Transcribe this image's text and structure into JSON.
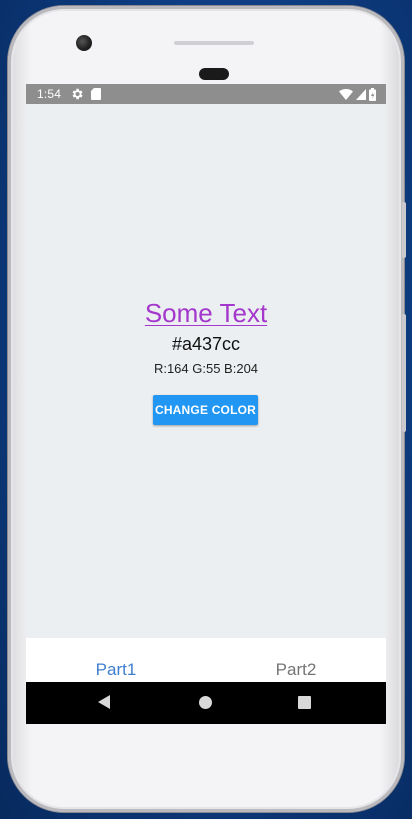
{
  "status_bar": {
    "time": "1:54",
    "icons": [
      "gear-icon",
      "sd-card-icon",
      "wifi-icon",
      "signal-icon",
      "battery-icon"
    ],
    "background": "#8e8e8e"
  },
  "main": {
    "sample_text": "Some Text",
    "sample_color": "#a437cc",
    "hex_label": "#a437cc",
    "rgb_label": "R:164 G:55 B:204",
    "button_label": "CHANGE COLOR",
    "button_color": "#2196f3",
    "background": "#eceff1"
  },
  "tabs": [
    {
      "label": "Part1",
      "active": true,
      "color": "#3f7fd0"
    },
    {
      "label": "Part2",
      "active": false,
      "color": "#757575"
    }
  ],
  "nav_bar": {
    "buttons": [
      "back-icon",
      "home-icon",
      "recents-icon"
    ]
  }
}
